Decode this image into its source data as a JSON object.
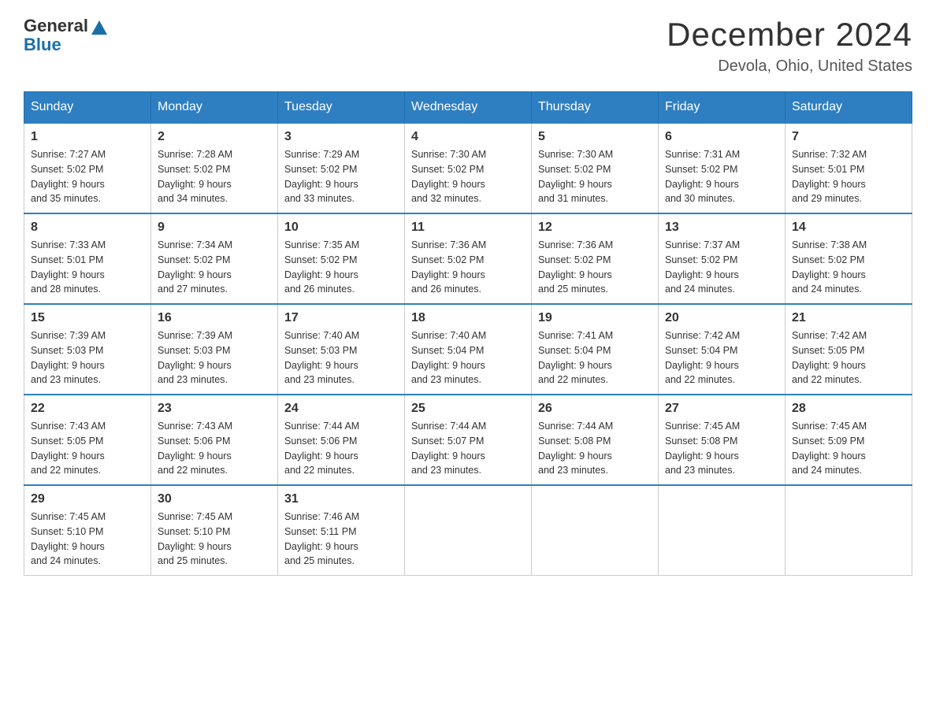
{
  "header": {
    "logo_general": "General",
    "logo_blue": "Blue",
    "month_title": "December 2024",
    "location": "Devola, Ohio, United States"
  },
  "days_of_week": [
    "Sunday",
    "Monday",
    "Tuesday",
    "Wednesday",
    "Thursday",
    "Friday",
    "Saturday"
  ],
  "weeks": [
    [
      {
        "day": "1",
        "sunrise": "7:27 AM",
        "sunset": "5:02 PM",
        "daylight": "9 hours and 35 minutes."
      },
      {
        "day": "2",
        "sunrise": "7:28 AM",
        "sunset": "5:02 PM",
        "daylight": "9 hours and 34 minutes."
      },
      {
        "day": "3",
        "sunrise": "7:29 AM",
        "sunset": "5:02 PM",
        "daylight": "9 hours and 33 minutes."
      },
      {
        "day": "4",
        "sunrise": "7:30 AM",
        "sunset": "5:02 PM",
        "daylight": "9 hours and 32 minutes."
      },
      {
        "day": "5",
        "sunrise": "7:30 AM",
        "sunset": "5:02 PM",
        "daylight": "9 hours and 31 minutes."
      },
      {
        "day": "6",
        "sunrise": "7:31 AM",
        "sunset": "5:02 PM",
        "daylight": "9 hours and 30 minutes."
      },
      {
        "day": "7",
        "sunrise": "7:32 AM",
        "sunset": "5:01 PM",
        "daylight": "9 hours and 29 minutes."
      }
    ],
    [
      {
        "day": "8",
        "sunrise": "7:33 AM",
        "sunset": "5:01 PM",
        "daylight": "9 hours and 28 minutes."
      },
      {
        "day": "9",
        "sunrise": "7:34 AM",
        "sunset": "5:02 PM",
        "daylight": "9 hours and 27 minutes."
      },
      {
        "day": "10",
        "sunrise": "7:35 AM",
        "sunset": "5:02 PM",
        "daylight": "9 hours and 26 minutes."
      },
      {
        "day": "11",
        "sunrise": "7:36 AM",
        "sunset": "5:02 PM",
        "daylight": "9 hours and 26 minutes."
      },
      {
        "day": "12",
        "sunrise": "7:36 AM",
        "sunset": "5:02 PM",
        "daylight": "9 hours and 25 minutes."
      },
      {
        "day": "13",
        "sunrise": "7:37 AM",
        "sunset": "5:02 PM",
        "daylight": "9 hours and 24 minutes."
      },
      {
        "day": "14",
        "sunrise": "7:38 AM",
        "sunset": "5:02 PM",
        "daylight": "9 hours and 24 minutes."
      }
    ],
    [
      {
        "day": "15",
        "sunrise": "7:39 AM",
        "sunset": "5:03 PM",
        "daylight": "9 hours and 23 minutes."
      },
      {
        "day": "16",
        "sunrise": "7:39 AM",
        "sunset": "5:03 PM",
        "daylight": "9 hours and 23 minutes."
      },
      {
        "day": "17",
        "sunrise": "7:40 AM",
        "sunset": "5:03 PM",
        "daylight": "9 hours and 23 minutes."
      },
      {
        "day": "18",
        "sunrise": "7:40 AM",
        "sunset": "5:04 PM",
        "daylight": "9 hours and 23 minutes."
      },
      {
        "day": "19",
        "sunrise": "7:41 AM",
        "sunset": "5:04 PM",
        "daylight": "9 hours and 22 minutes."
      },
      {
        "day": "20",
        "sunrise": "7:42 AM",
        "sunset": "5:04 PM",
        "daylight": "9 hours and 22 minutes."
      },
      {
        "day": "21",
        "sunrise": "7:42 AM",
        "sunset": "5:05 PM",
        "daylight": "9 hours and 22 minutes."
      }
    ],
    [
      {
        "day": "22",
        "sunrise": "7:43 AM",
        "sunset": "5:05 PM",
        "daylight": "9 hours and 22 minutes."
      },
      {
        "day": "23",
        "sunrise": "7:43 AM",
        "sunset": "5:06 PM",
        "daylight": "9 hours and 22 minutes."
      },
      {
        "day": "24",
        "sunrise": "7:44 AM",
        "sunset": "5:06 PM",
        "daylight": "9 hours and 22 minutes."
      },
      {
        "day": "25",
        "sunrise": "7:44 AM",
        "sunset": "5:07 PM",
        "daylight": "9 hours and 23 minutes."
      },
      {
        "day": "26",
        "sunrise": "7:44 AM",
        "sunset": "5:08 PM",
        "daylight": "9 hours and 23 minutes."
      },
      {
        "day": "27",
        "sunrise": "7:45 AM",
        "sunset": "5:08 PM",
        "daylight": "9 hours and 23 minutes."
      },
      {
        "day": "28",
        "sunrise": "7:45 AM",
        "sunset": "5:09 PM",
        "daylight": "9 hours and 24 minutes."
      }
    ],
    [
      {
        "day": "29",
        "sunrise": "7:45 AM",
        "sunset": "5:10 PM",
        "daylight": "9 hours and 24 minutes."
      },
      {
        "day": "30",
        "sunrise": "7:45 AM",
        "sunset": "5:10 PM",
        "daylight": "9 hours and 25 minutes."
      },
      {
        "day": "31",
        "sunrise": "7:46 AM",
        "sunset": "5:11 PM",
        "daylight": "9 hours and 25 minutes."
      },
      null,
      null,
      null,
      null
    ]
  ],
  "labels": {
    "sunrise_prefix": "Sunrise: ",
    "sunset_prefix": "Sunset: ",
    "daylight_prefix": "Daylight: "
  }
}
